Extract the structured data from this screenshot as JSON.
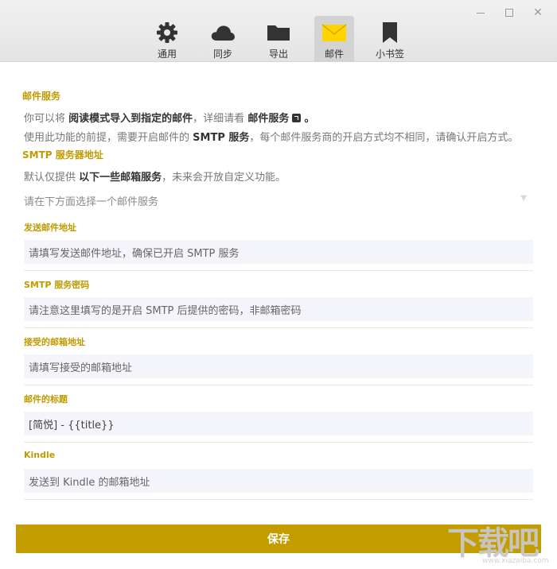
{
  "window": {
    "controls": [
      "minimize",
      "maximize",
      "close"
    ],
    "close_glyph": "✕"
  },
  "tabs": [
    {
      "id": "general",
      "label": "通用",
      "icon": "gear-icon"
    },
    {
      "id": "sync",
      "label": "同步",
      "icon": "cloud-icon"
    },
    {
      "id": "export",
      "label": "导出",
      "icon": "folder-icon"
    },
    {
      "id": "mail",
      "label": "邮件",
      "icon": "envelope-icon",
      "active": true
    },
    {
      "id": "bookmark",
      "label": "小书签",
      "icon": "bookmark-icon"
    }
  ],
  "colors": {
    "accent": "#c09a00",
    "button": "#c39c00",
    "mail_icon": "#ffd400",
    "field_bg": "#f4f4fb"
  },
  "mail_service": {
    "title": "邮件服务",
    "line1_prefix": "你可以将",
    "line1_bold": "阅读模式导入到指定的邮件",
    "line1_mid": "，详细请看",
    "line1_link": "邮件服务",
    "line1_suffix": "。",
    "line2_prefix": "使用此功能的前提，需要开启邮件的",
    "line2_bold": "SMTP 服务",
    "line2_suffix": "，每个邮件服务商的开启方式均不相同，请确认开启方式。"
  },
  "smtp_server": {
    "title": "SMTP 服务器地址",
    "line_prefix": "默认仅提供",
    "line_bold": "以下一些邮箱服务",
    "line_suffix": "，未来会开放自定义功能。",
    "select_placeholder": "请在下方面选择一个邮件服务",
    "chevron": "▼"
  },
  "fields": {
    "sender": {
      "label": "发送邮件地址",
      "placeholder": "请填写发送邮件地址，确保已开启 SMTP 服务"
    },
    "password": {
      "label": "SMTP 服务密码",
      "placeholder": "请注意这里填写的是开启 SMTP 后提供的密码，非邮箱密码"
    },
    "receiver": {
      "label": "接受的邮箱地址",
      "placeholder": "请填写接受的邮箱地址"
    },
    "subject": {
      "label": "邮件的标题",
      "value": "[简悦] - {{title}}"
    },
    "kindle": {
      "label": "Kindle",
      "placeholder": "发送到 Kindle 的邮箱地址"
    }
  },
  "save_label": "保存",
  "watermark": {
    "main": "下载吧",
    "sub": "www.xiazaiba.com"
  }
}
